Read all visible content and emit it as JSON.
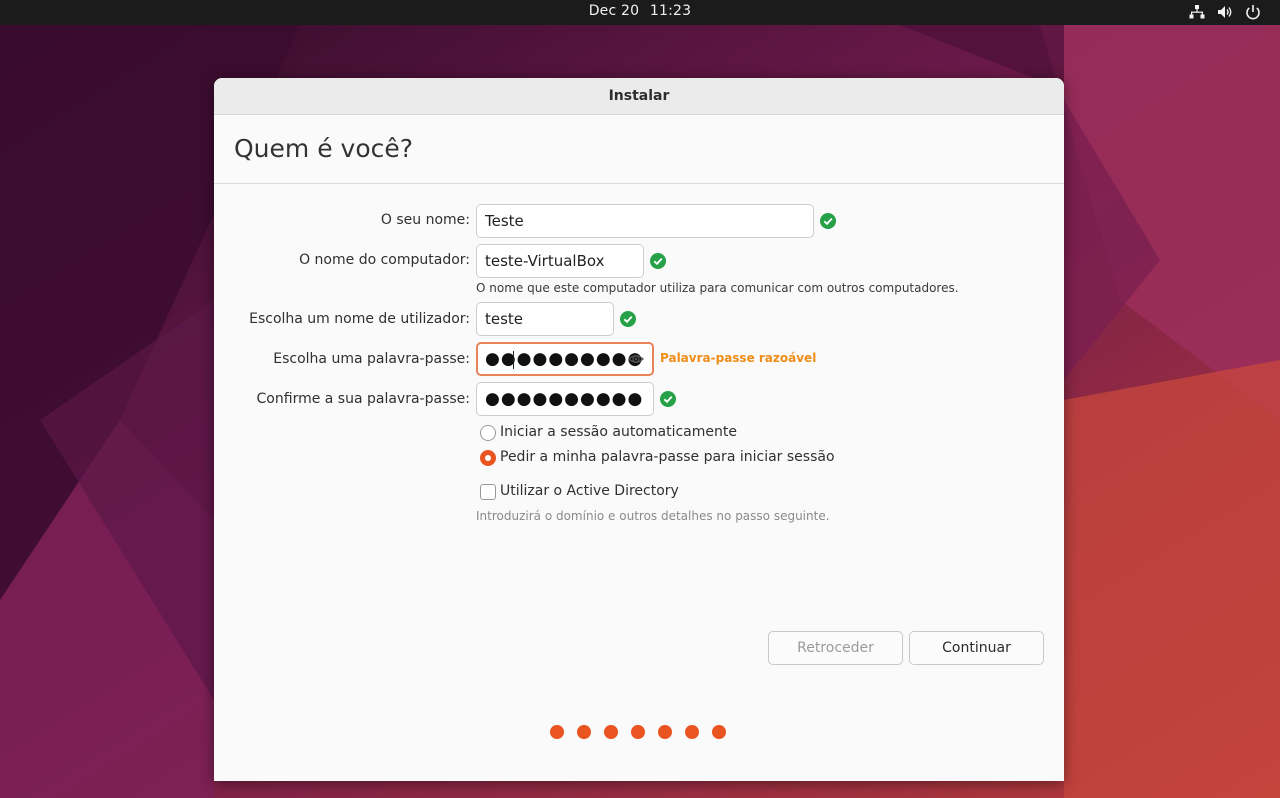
{
  "topbar": {
    "date": "Dec 20",
    "time": "11:23",
    "icons": [
      "network-icon",
      "volume-icon",
      "power-icon"
    ]
  },
  "window": {
    "title": "Instalar",
    "heading": "Quem é você?"
  },
  "form": {
    "name": {
      "label": "O seu nome:",
      "value": "Teste",
      "valid": true
    },
    "computer": {
      "label": "O nome do computador:",
      "value": "teste-VirtualBox",
      "valid": true,
      "hint": "O nome que este computador utiliza para comunicar com outros computadores."
    },
    "username": {
      "label": "Escolha um nome de utilizador:",
      "value": "teste",
      "valid": true
    },
    "password": {
      "label": "Escolha uma palavra-passe:",
      "masked": "●●●●●●●●●●",
      "strength": "Palavra-passe razoável",
      "reveal_icon": "eye-icon"
    },
    "confirm": {
      "label": "Confirme a sua palavra-passe:",
      "masked": "●●●●●●●●●●",
      "valid": true
    },
    "login_options": [
      {
        "label": "Iniciar a sessão automaticamente",
        "selected": false
      },
      {
        "label": "Pedir a minha palavra-passe para iniciar sessão",
        "selected": true
      }
    ],
    "active_directory": {
      "label": "Utilizar o Active Directory",
      "checked": false,
      "hint": "Introduzirá o domínio e outros detalhes no passo seguinte."
    }
  },
  "buttons": {
    "back": "Retroceder",
    "continue": "Continuar"
  },
  "progress": {
    "total_steps": 7,
    "completed_steps": 7
  },
  "colors": {
    "accent": "#e95420",
    "valid": "#26a148",
    "warning": "#ef8d17",
    "focus_border": "#e9835a",
    "topbar": "#1b1b1b"
  }
}
